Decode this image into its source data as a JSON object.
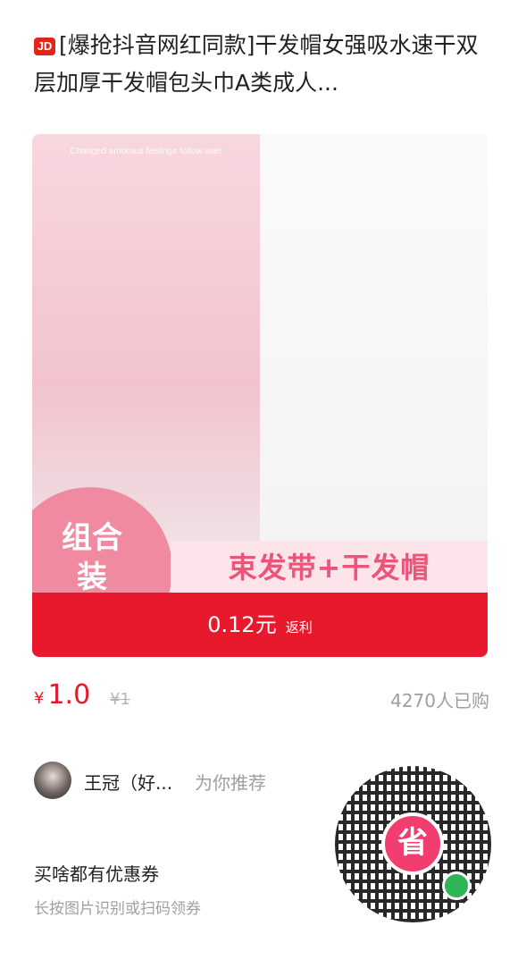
{
  "title": {
    "badge": "JD",
    "text": "[爆抢抖音网红同款]干发帽女强吸水速干双层加厚干发帽包头巾A类成人..."
  },
  "product": {
    "photo_caption": "Changed amorous feelings follow user",
    "combo_line1": "组合",
    "combo_line2": "装",
    "band_text": "束发带+干发帽",
    "rebate_amount": "0.12元",
    "rebate_label": "返利",
    "colors": {
      "rebate_bar": "#e8192c",
      "combo_circle": "#f08aa0",
      "band_text": "#e9567a"
    }
  },
  "price": {
    "currency": "¥",
    "current": "1.0",
    "original": "¥1",
    "sold": "4270人已购"
  },
  "recommend": {
    "name": "王冠（好...",
    "suffix": "为你推荐",
    "avatar_icon": "user-avatar"
  },
  "footer": {
    "title": "买啥都有优惠券",
    "subtitle": "长按图片识别或扫码领券"
  },
  "qr": {
    "center_text": "省",
    "badge_icon": "mini-program-icon"
  }
}
